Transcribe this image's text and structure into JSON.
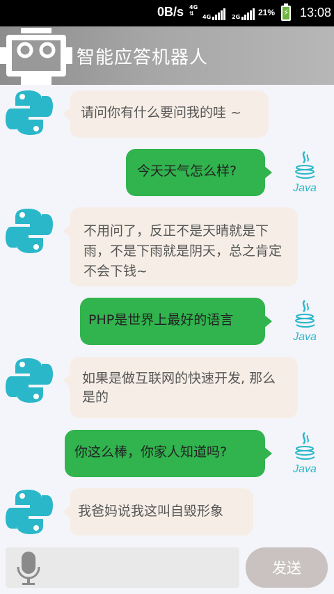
{
  "status_bar": {
    "net_speed": "0B/s",
    "net_type": "4G",
    "signal1_label": "4G",
    "signal2_label": "2G",
    "battery": "21%",
    "time": "13:08"
  },
  "header": {
    "title": "智能应答机器人",
    "icon": "robot-icon"
  },
  "messages": [
    {
      "from": "bot",
      "avatar": "python-icon",
      "text": "请问你有什么要问我的哇 ~"
    },
    {
      "from": "user",
      "avatar": "java-icon",
      "avatar_label": "Java",
      "text": "今天天气怎么样?"
    },
    {
      "from": "bot",
      "avatar": "python-icon",
      "text": "不用问了，反正不是天晴就是下雨，不是下雨就是阴天，总之肯定不会下钱~"
    },
    {
      "from": "user",
      "avatar": "java-icon",
      "avatar_label": "Java",
      "text": "PHP是世界上最好的语言"
    },
    {
      "from": "bot",
      "avatar": "python-icon",
      "text": "如果是做互联网的快速开发, 那么 是的"
    },
    {
      "from": "user",
      "avatar": "java-icon",
      "avatar_label": "Java",
      "text": "你这么棒，你家人知道吗?"
    },
    {
      "from": "bot",
      "avatar": "python-icon",
      "text": "我爸妈说我这叫自毁形象"
    }
  ],
  "input": {
    "mic_icon": "microphone-icon",
    "value": "",
    "send_label": "发送"
  },
  "colors": {
    "bot_bubble": "#f6eee6",
    "user_bubble": "#31b34e",
    "send_button": "#c9c2c0"
  }
}
